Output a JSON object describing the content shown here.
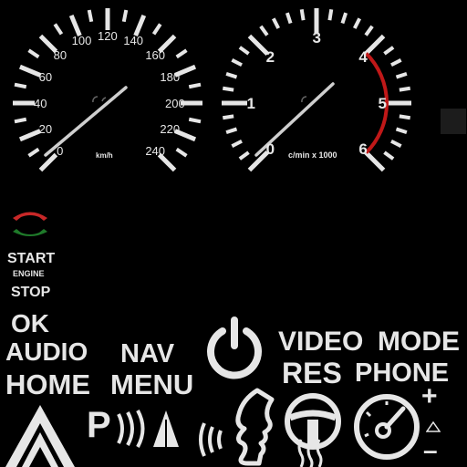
{
  "speedometer": {
    "labels": [
      "0",
      "20",
      "40",
      "60",
      "80",
      "100",
      "120",
      "140",
      "160",
      "180",
      "200",
      "220",
      "240"
    ],
    "unit": "km/h"
  },
  "tachometer": {
    "labels": [
      "0",
      "1",
      "2",
      "3",
      "4",
      "5",
      "6"
    ],
    "unit": "c/min x 1000"
  },
  "buttons": {
    "start": "START",
    "engine": "ENGINE",
    "stop": "STOP",
    "ok": "OK",
    "audio": "AUDIO",
    "home": "HOME",
    "nav": "NAV",
    "menu": "MENU",
    "video": "VIDEO",
    "mode": "MODE",
    "res": "RES",
    "phone": "PHONE",
    "park_letter": "P",
    "plus": "+",
    "minus": "–"
  },
  "colors": {
    "foreground": "#e6e6e6",
    "redline": "#c01818",
    "hangup_red": "#c82828",
    "answer_green": "#1f7a2a",
    "background": "#000000"
  },
  "icons": [
    "hangup-icon",
    "answer-icon",
    "power-icon",
    "hazard-icon",
    "park-assist-icon",
    "voice-command-icon",
    "steering-heat-icon",
    "sport-mode-icon",
    "triangle-small-icon"
  ]
}
